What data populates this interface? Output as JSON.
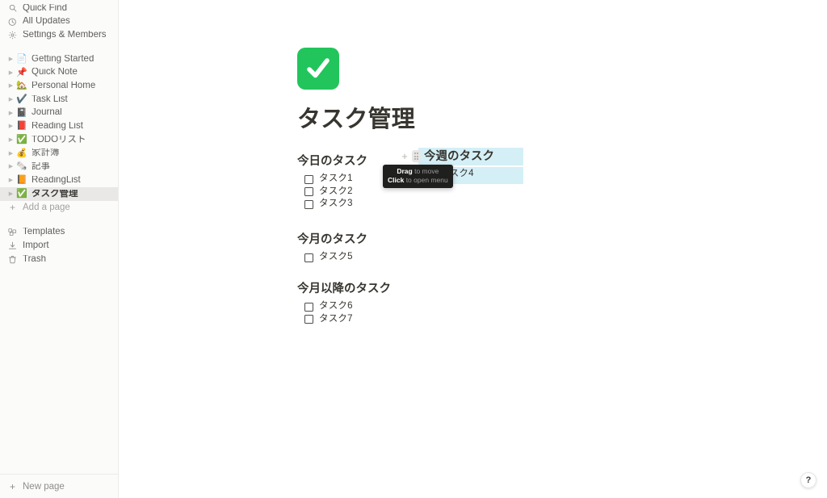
{
  "sidebar": {
    "top_items": [
      {
        "label": "Quick Find",
        "icon": "search-icon"
      },
      {
        "label": "All Updates",
        "icon": "clock-icon"
      },
      {
        "label": "Settings & Members",
        "icon": "gear-icon"
      }
    ],
    "pages": [
      {
        "label": "Getting Started",
        "emoji": "📄"
      },
      {
        "label": "Quick Note",
        "emoji": "📌"
      },
      {
        "label": "Personal Home",
        "emoji": "🏡"
      },
      {
        "label": "Task List",
        "emoji": "✔️"
      },
      {
        "label": "Journal",
        "emoji": "📓"
      },
      {
        "label": "Reading List",
        "emoji": "📕"
      },
      {
        "label": "TODOリスト",
        "emoji": "✅"
      },
      {
        "label": "家計簿",
        "emoji": "💰"
      },
      {
        "label": "記事",
        "emoji": "🗞️"
      },
      {
        "label": "ReadingList",
        "emoji": "📙"
      },
      {
        "label": "タスク管理",
        "emoji": "✅",
        "selected": true
      }
    ],
    "add_a_page": "Add a page",
    "bottom_items": [
      {
        "label": "Templates",
        "icon": "templates-icon"
      },
      {
        "label": "Import",
        "icon": "import-icon"
      },
      {
        "label": "Trash",
        "icon": "trash-icon"
      }
    ],
    "new_page": "New page"
  },
  "page": {
    "icon_emoji": "✅",
    "title": "タスク管理",
    "sections": [
      {
        "heading": "今日のタスク",
        "todos": [
          "タスク1",
          "タスク2",
          "タスク3"
        ]
      },
      {
        "heading": "今週のタスク",
        "todos": [
          "タスク4"
        ],
        "highlighted": true
      },
      {
        "heading": "今月のタスク",
        "todos": [
          "タスク5"
        ]
      },
      {
        "heading": "今月以降のタスク",
        "todos": [
          "タスク6",
          "タスク7"
        ]
      }
    ]
  },
  "tooltip": {
    "line1_strong": "Drag",
    "line1_rest": " to move",
    "line2_strong": "Click",
    "line2_rest": " to open menu"
  },
  "help_button": {
    "label": "?"
  },
  "colors": {
    "selection_highlight": "#d4eff6",
    "sidebar_bg": "#fbfbfa",
    "page_icon_green": "#22c55b",
    "text_primary": "#37352f",
    "tooltip_bg": "#1f1f1e"
  }
}
